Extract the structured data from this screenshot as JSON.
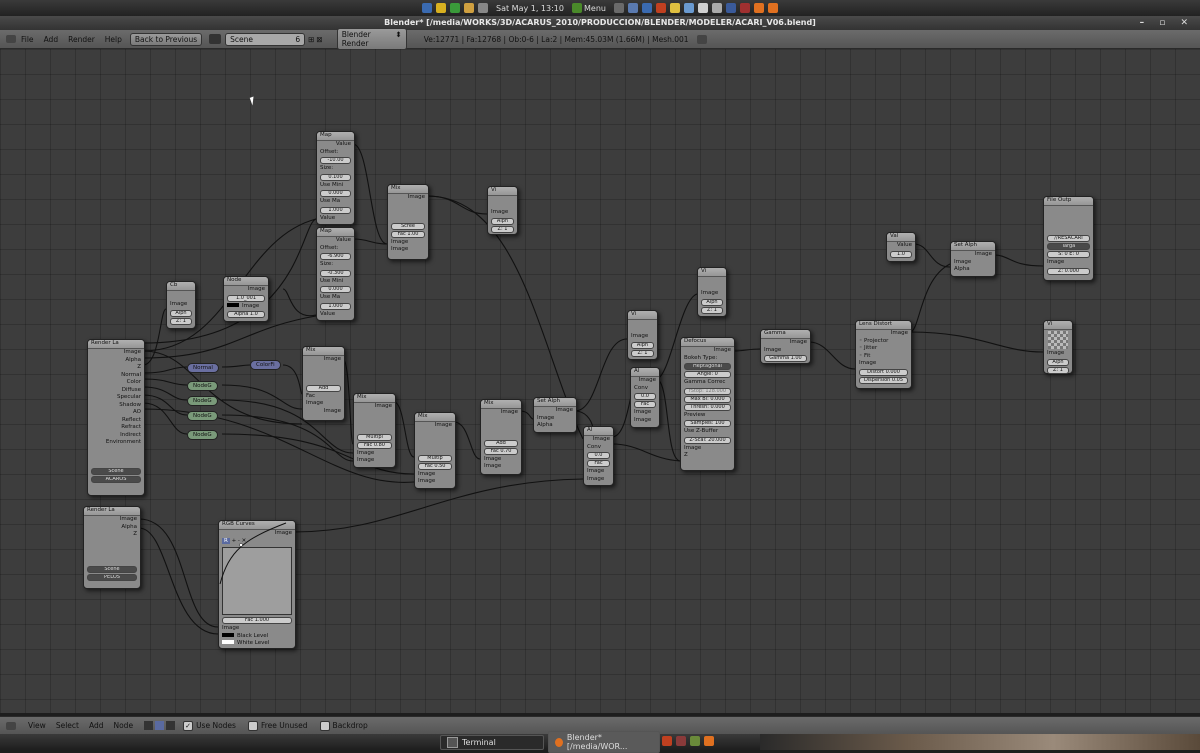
{
  "topbar": {
    "clock": "Sat May  1, 13:10",
    "menu_label": "Menu"
  },
  "window": {
    "title": "Blender* [/media/WORKS/3D/ACARUS_2010/PRODUCCION/BLENDER/MODELER/ACARI_V06.blend]"
  },
  "header": {
    "menus": [
      "File",
      "Add",
      "Render",
      "Help"
    ],
    "back_button": "Back to Previous",
    "scene_name": "Scene",
    "scene_users": "6",
    "engine": "Blender Render",
    "stats": "Ve:12771 | Fa:12768 | Ob:0-6 | La:2 | Mem:45.03M (1.66M) | Mesh.001"
  },
  "nodes": {
    "map1": {
      "title": "Map",
      "value_out": "Value",
      "offset_label": "Offset:",
      "offset": "-10.00",
      "size_label": "Size:",
      "size": "0.100",
      "use_min": "Use Mini",
      "min": "0.000",
      "use_max": "Use Ma",
      "max": "1.000",
      "value_in": "Value"
    },
    "map2": {
      "title": "Map",
      "value_out": "Value",
      "offset_label": "Offset:",
      "offset": "-6.900",
      "size_label": "Size:",
      "size": "-0.300",
      "use_min": "Use Mini",
      "min": "0.000",
      "use_max": "Use Ma",
      "max": "1.000",
      "value_in": "Value"
    },
    "mix_top": {
      "title": "Mix",
      "image_out": "Image",
      "blend": "Scree",
      "fac": "Fac 1.00",
      "image1": "Image",
      "image2": "Image"
    },
    "vi_top": {
      "title": "Vi",
      "image": "Image",
      "alpha": "Alph",
      "z": "Z: 1"
    },
    "cb": {
      "title": "Cb",
      "image": "Image",
      "alpha": "Alph",
      "z": "Z: 1"
    },
    "node": {
      "title": "Node",
      "image_out": "Image",
      "id": "1.0_001",
      "image_in": "Image",
      "alpha": "Alpha 1.0"
    },
    "render1": {
      "title": "Render La",
      "sockets": [
        "Image",
        "Alpha",
        "Z",
        "Normal",
        "Color",
        "Diffuse",
        "Specular",
        "Shadow",
        "AO",
        "Reflect",
        "Refract",
        "Indirect",
        "Environment"
      ],
      "scene": "Scene",
      "layer": "ACAROS"
    },
    "render2": {
      "title": "Render La",
      "sockets": [
        "Image",
        "Alpha",
        "Z"
      ],
      "scene": "Scene",
      "layer": "PELOS"
    },
    "normal_pill": "Normal",
    "colorfi_pill": "ColorFi",
    "nodeg_pills": [
      "NodeG",
      "NodeG",
      "NodeG",
      "NodeG"
    ],
    "mix_a": {
      "title": "Mix",
      "image_out": "Image",
      "blend": "Add",
      "fac": "Fac",
      "image1": "Image",
      "image2": "Image"
    },
    "mix_b": {
      "title": "Mix",
      "image_out": "Image",
      "blend": "Multipl",
      "fac": "Fac 0.80",
      "image1": "Image",
      "image2": "Image"
    },
    "mix_c": {
      "title": "Mix",
      "image_out": "Image",
      "blend": "Multip",
      "fac": "Fac 0.50",
      "image1": "Image",
      "image2": "Image"
    },
    "mix_d": {
      "title": "Mix",
      "image_out": "Image",
      "blend": "Add",
      "fac": "Fac 0.70",
      "image1": "Image",
      "image2": "Image"
    },
    "setalpha1": {
      "title": "Set Alph",
      "image_out": "Image",
      "image": "Image",
      "alpha": "Alpha"
    },
    "alpha_over1": {
      "title": "Al",
      "image_out": "Image",
      "convert": "Conv",
      "val": "0.0",
      "fac": "Fac",
      "image1": "Image",
      "image2": "Image"
    },
    "alpha_over2": {
      "title": "Al",
      "image_out": "Image",
      "convert": "Conv",
      "val": "0.0",
      "fac": "Fac",
      "image1": "Image",
      "image2": "Image"
    },
    "vi_mid": {
      "title": "Vi",
      "image": "Image",
      "alpha": "Alph",
      "z": "Z: 1"
    },
    "vi_right": {
      "title": "Vi",
      "image": "Image",
      "alpha": "Alph",
      "z": "Z: 1"
    },
    "defocus": {
      "title": "Defocus",
      "image_out": "Image",
      "bokeh_label": "Bokeh Type:",
      "bokeh": "Heptagonal",
      "angle": "Angle: 0",
      "gamma_corr": "Gamma Correc",
      "fstop": "fStop: 128.000",
      "maxblur": "Max Bl: 0.000",
      "thresh": "Thresh: 0.000",
      "preview": "Preview",
      "samples": "Samples: 100",
      "use_z": "Use Z-Buffer",
      "zscale": "Z-Scal: 20.000",
      "image_in": "Image",
      "z_in": "Z"
    },
    "gamma": {
      "title": "Gamma",
      "image_out": "Image",
      "image_in": "Image",
      "gamma": "Gamma 1.00"
    },
    "lens": {
      "title": "Lens Distort",
      "image_out": "Image",
      "projector": "Projector",
      "jitter": "Jitter",
      "fit": "Fit",
      "image_in": "Image",
      "distort": "Distort 0.000",
      "dispersion": "Dispersion 0.05"
    },
    "val": {
      "title": "Val",
      "value_out": "Value",
      "value": "1.0"
    },
    "setalpha2": {
      "title": "Set Alph",
      "image_out": "Image",
      "image": "Image",
      "alpha": "Alpha"
    },
    "fileout": {
      "title": "File Outp",
      "path": "//RESACARI",
      "format": "Targa",
      "frames": "S: 0   E: 0",
      "image": "Image",
      "z": "Z: 0.000"
    },
    "viewer_final": {
      "title": "Vi",
      "image": "Image",
      "alpha": "Alph",
      "z": "Z: 1"
    },
    "rgbcurves": {
      "title": "RGB Curves",
      "image_out": "Image",
      "channels": "R",
      "fac": "Fac 1.000",
      "image_in": "Image",
      "black": "Black Level",
      "white": "White Level"
    }
  },
  "footer": {
    "menus": [
      "View",
      "Select",
      "Add",
      "Node"
    ],
    "use_nodes": "Use Nodes",
    "free_unused": "Free Unused",
    "backdrop": "Backdrop"
  },
  "taskbar": {
    "terminal": "Terminal",
    "blender": "Blender* [/media/WOR..."
  },
  "colors": {
    "canvas": "#3d3d3d",
    "node_body": "#8a8a8a",
    "socket_yellow": "#e8e020",
    "socket_gray": "#a0a0a0",
    "socket_blue": "#6a6fd0"
  }
}
